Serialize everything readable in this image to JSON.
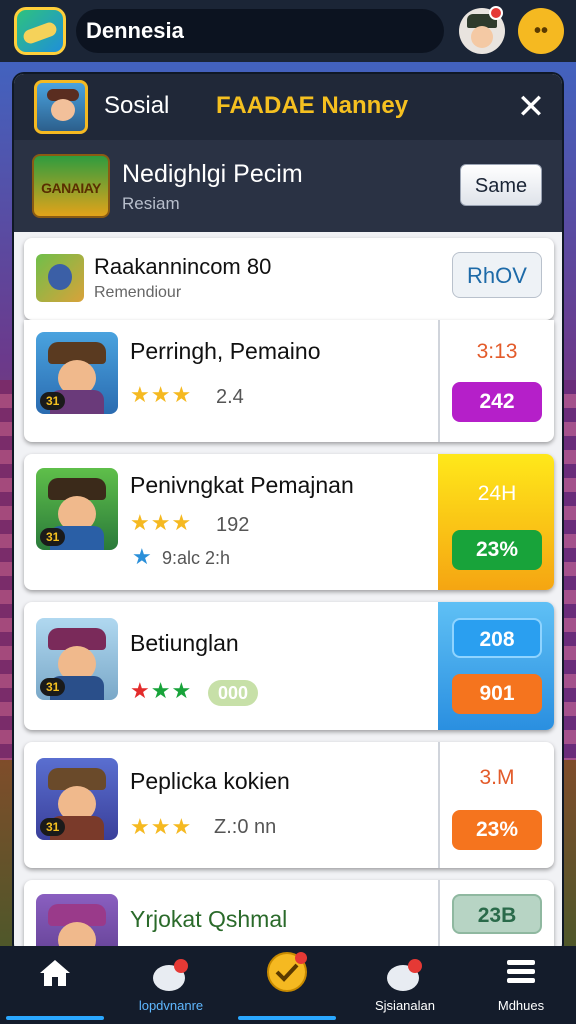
{
  "topbar": {
    "search_value": "Dennesia",
    "menu_glyph": "••"
  },
  "panel": {
    "header": {
      "title": "Sosial",
      "subtitle": "FAADAE Nanney",
      "close_glyph": "✕"
    },
    "subheader": {
      "logo_text": "GANAIAY",
      "title": "Nedighlgi Pecim",
      "caption": "Resiam",
      "button_label": "Same"
    },
    "summary": {
      "title": "Raakannincom 80",
      "caption": "Remendiour",
      "filter_label": "RhOV"
    },
    "rows": [
      {
        "name": "Perringh, Pemaino",
        "rating": "2.4",
        "value": "3:13",
        "pill": "242",
        "badge": "31"
      },
      {
        "name": "Penivngkat Pemajnan",
        "rating": "192",
        "extra": "9:alc 2:h",
        "value": "24H",
        "pill": "23%",
        "badge": "31"
      },
      {
        "name": "Betiunglan",
        "rank": "000",
        "value": "208",
        "pill": "901",
        "badge": "31"
      },
      {
        "name": "Peplicka kokien",
        "rating": "Z.:0 nn",
        "value": "3.M",
        "pill": "23%",
        "badge": "31"
      },
      {
        "name": "Yrjokat Qshmal",
        "value": "23B"
      }
    ]
  },
  "nav": [
    {
      "label": "",
      "icon": "home-icon",
      "active": true
    },
    {
      "label": "lopdvnanre",
      "icon": "chat-icon"
    },
    {
      "label": "",
      "icon": "badge-check-icon",
      "active": true
    },
    {
      "label": "Sjsianalan",
      "icon": "chat-bubble-icon"
    },
    {
      "label": "Mdhues",
      "icon": "menu-icon"
    }
  ],
  "colors": {
    "accent": "#f5c020",
    "purple_pill": "#b51fc9",
    "green_pill": "#18a33a",
    "orange_pill": "#f5741e",
    "blue_pill": "#2a9ff0"
  }
}
